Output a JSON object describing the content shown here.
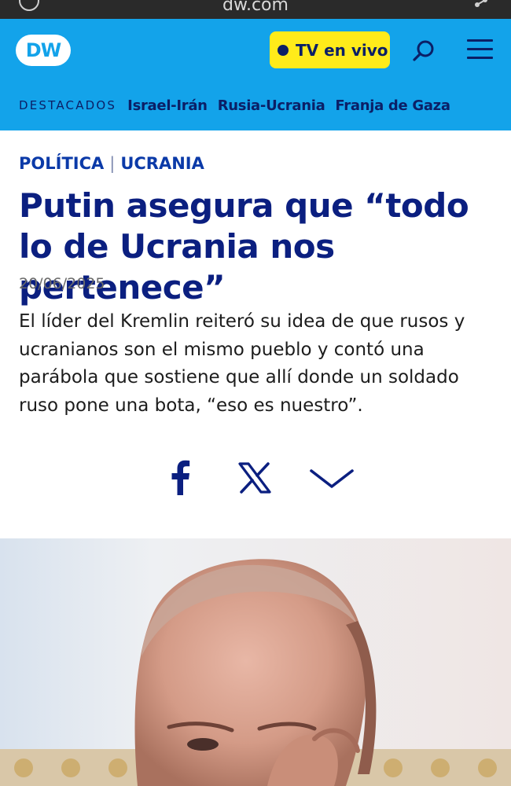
{
  "browser": {
    "url": "dw.com",
    "info_icon": "info-icon",
    "share_icon": "share-icon"
  },
  "header": {
    "logo_text": "DW",
    "tv_button_label": "TV en vivo",
    "search_icon": "search-icon",
    "menu_icon": "hamburger-menu-icon",
    "nav_label": "DESTACADOS",
    "nav_links": [
      "Israel-Irán",
      "Rusia-Ucrania",
      "Franja de Gaza"
    ]
  },
  "article": {
    "category_1": "POLÍTICA",
    "category_separator": "|",
    "category_2": "UCRANIA",
    "headline": "Putin asegura que “todo lo de Ucrania nos pertenece”",
    "date": "20/06/2025",
    "lede": "El líder del Kremlin reiteró su idea de que rusos y ucranianos son el mismo pueblo y contó una parábola que sostiene que allí donde un soldado ruso pone una bota, “eso es nuestro”."
  },
  "share": {
    "icons": [
      "facebook-icon",
      "x-icon",
      "chevron-down-icon"
    ]
  },
  "colors": {
    "header_bg": "#13a3ea",
    "navy": "#0b1f66",
    "headline": "#0b1f80",
    "tv_button_bg": "#ffeb1a"
  }
}
